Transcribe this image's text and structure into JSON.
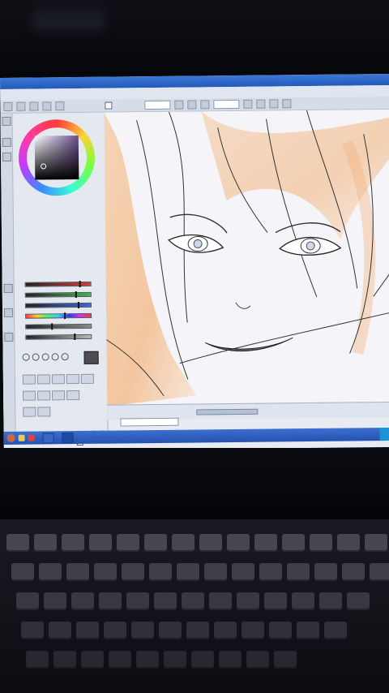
{
  "window": {
    "title": "",
    "menu": [
      "",
      "",
      "",
      "",
      "",
      "",
      ""
    ],
    "zoom": "",
    "angle": ""
  },
  "color_panel": {
    "sliders": [
      {
        "color": "#d23c3c",
        "level": 0.85
      },
      {
        "color": "#3cb84a",
        "level": 0.78
      },
      {
        "color": "#3c66d2",
        "level": 0.82
      },
      {
        "color": "rainbow",
        "level": 0.6
      },
      {
        "color": "#8a8a8a",
        "level": 0.4
      },
      {
        "color": "#b8b8b8",
        "level": 0.75
      }
    ]
  },
  "taskbar": {
    "items": [
      "",
      ""
    ],
    "tray": ""
  },
  "colors": {
    "titlebar": "#2459b8",
    "taskbar": "#2452b0",
    "hair_accent": "#f2b27a"
  }
}
